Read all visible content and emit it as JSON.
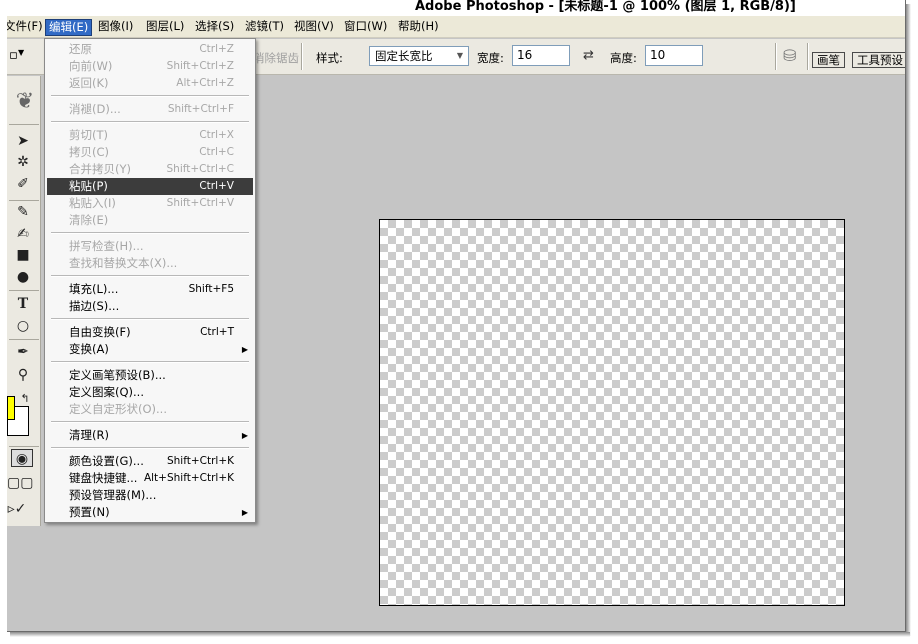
{
  "app": {
    "title": "Adobe Photoshop - [未标题-1 @ 100% (图层 1, RGB/8)]"
  },
  "menubar": {
    "items": [
      {
        "label": "文件(F)"
      },
      {
        "label": "编辑(E)"
      },
      {
        "label": "图像(I)"
      },
      {
        "label": "图层(L)"
      },
      {
        "label": "选择(S)"
      },
      {
        "label": "滤镜(T)"
      },
      {
        "label": "视图(V)"
      },
      {
        "label": "窗口(W)"
      },
      {
        "label": "帮助(H)"
      }
    ]
  },
  "options": {
    "antialias_label": "消除锯齿",
    "style_label": "样式:",
    "style_value": "固定长宽比",
    "width_label": "宽度:",
    "width_value": "16",
    "height_label": "高度:",
    "height_value": "10",
    "tabs": [
      {
        "label": "画笔"
      },
      {
        "label": "工具预设"
      }
    ]
  },
  "edit_menu": {
    "items": [
      {
        "label": "还原",
        "shortcut": "Ctrl+Z",
        "enabled": false
      },
      {
        "label": "向前(W)",
        "shortcut": "Shift+Ctrl+Z",
        "enabled": false
      },
      {
        "label": "返回(K)",
        "shortcut": "Alt+Ctrl+Z",
        "enabled": false
      },
      {
        "label": "消褪(D)...",
        "shortcut": "Shift+Ctrl+F",
        "enabled": false
      },
      {
        "label": "剪切(T)",
        "shortcut": "Ctrl+X",
        "enabled": false
      },
      {
        "label": "拷贝(C)",
        "shortcut": "Ctrl+C",
        "enabled": false
      },
      {
        "label": "合并拷贝(Y)",
        "shortcut": "Shift+Ctrl+C",
        "enabled": false
      },
      {
        "label": "粘贴(P)",
        "shortcut": "Ctrl+V",
        "enabled": true,
        "highlighted": true
      },
      {
        "label": "粘贴入(I)",
        "shortcut": "Shift+Ctrl+V",
        "enabled": false
      },
      {
        "label": "清除(E)",
        "shortcut": "",
        "enabled": false
      },
      {
        "label": "拼写检查(H)...",
        "shortcut": "",
        "enabled": false
      },
      {
        "label": "查找和替换文本(X)...",
        "shortcut": "",
        "enabled": false
      },
      {
        "label": "填充(L)...",
        "shortcut": "Shift+F5",
        "enabled": true
      },
      {
        "label": "描边(S)...",
        "shortcut": "",
        "enabled": true
      },
      {
        "label": "自由变换(F)",
        "shortcut": "Ctrl+T",
        "enabled": true
      },
      {
        "label": "变换(A)",
        "shortcut": "",
        "enabled": true,
        "submenu": true
      },
      {
        "label": "定义画笔预设(B)...",
        "shortcut": "",
        "enabled": true
      },
      {
        "label": "定义图案(Q)...",
        "shortcut": "",
        "enabled": true
      },
      {
        "label": "定义自定形状(O)...",
        "shortcut": "",
        "enabled": false
      },
      {
        "label": "清理(R)",
        "shortcut": "",
        "enabled": true,
        "submenu": true
      },
      {
        "label": "颜色设置(G)...",
        "shortcut": "Shift+Ctrl+K",
        "enabled": true
      },
      {
        "label": "键盘快捷键...",
        "shortcut": "Alt+Shift+Ctrl+K",
        "enabled": true
      },
      {
        "label": "预设管理器(M)...",
        "shortcut": "",
        "enabled": true
      },
      {
        "label": "预置(N)",
        "shortcut": "",
        "enabled": true,
        "submenu": true
      }
    ]
  },
  "colors": {
    "foreground": "#ffff00",
    "background": "#ffffff",
    "highlight": "#3c3c3c"
  }
}
